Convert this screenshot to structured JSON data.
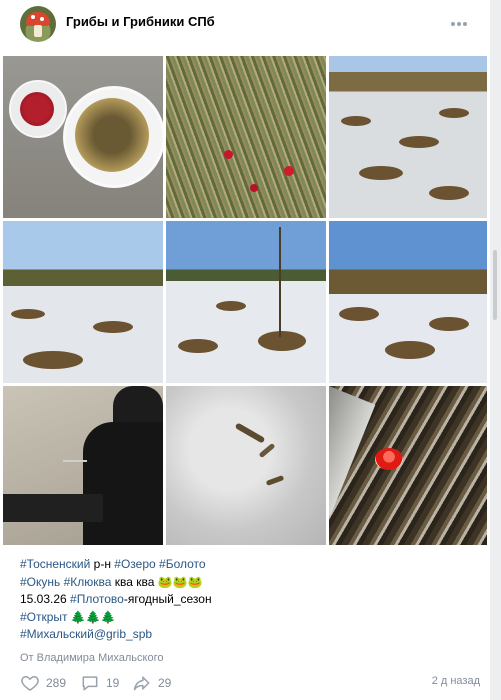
{
  "group": {
    "name": "Грибы и Грибники СПб",
    "more_icon": "more-horizontal-icon"
  },
  "photos": [
    {
      "subject": "bucket-of-cranberries-and-perch"
    },
    {
      "subject": "cranberries-in-grass"
    },
    {
      "subject": "snowy-bog"
    },
    {
      "subject": "snowy-bog-trees"
    },
    {
      "subject": "snowy-bog-pines"
    },
    {
      "subject": "snowy-bog-hummocks"
    },
    {
      "subject": "ice-fishing"
    },
    {
      "subject": "fish-on-ice"
    },
    {
      "subject": "red-cup-mushroom"
    }
  ],
  "post": {
    "line1": [
      {
        "text": "#Тосненский",
        "tag": true
      },
      {
        "text": " р-н ",
        "tag": false
      },
      {
        "text": "#Озеро",
        "tag": true
      },
      {
        "text": " ",
        "tag": false
      },
      {
        "text": "#Болото",
        "tag": true
      }
    ],
    "line2": [
      {
        "text": "#Окунь",
        "tag": true
      },
      {
        "text": " ",
        "tag": false
      },
      {
        "text": "#Клюква",
        "tag": true
      },
      {
        "text": " ква ква 🐸🐸🐸",
        "tag": false
      }
    ],
    "line3": [
      {
        "text": "15.03.26 ",
        "tag": false
      },
      {
        "text": "#Плотово",
        "tag": true
      },
      {
        "text": "-ягодный_сезон",
        "tag": false
      }
    ],
    "line4": [
      {
        "text": "#Открыт",
        "tag": true
      },
      {
        "text": " 🌲🌲🌲",
        "tag": false
      }
    ],
    "line5": [
      {
        "text": "#Михальский@grib_spb",
        "tag": true
      }
    ]
  },
  "author_line": "От Владимира Михальского",
  "actions": {
    "likes": "289",
    "comments": "19",
    "shares": "29",
    "time": "2 д назад"
  },
  "colors": {
    "link": "#2a5885",
    "muted": "#818c99",
    "background": "#edeef0",
    "card": "#ffffff"
  }
}
